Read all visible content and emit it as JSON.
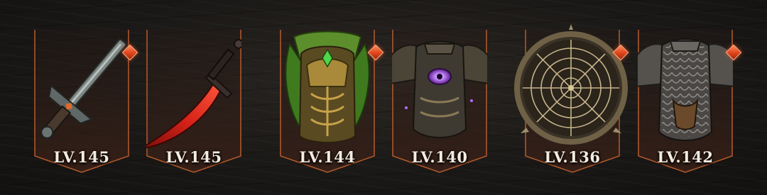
{
  "accent_color": "#e0551f",
  "frame_color": "#b55a2c",
  "equipment": [
    {
      "slot": "sword",
      "icon": "broadsword-icon",
      "level": "LV.145",
      "enhanced": true
    },
    {
      "slot": "dagger",
      "icon": "red-dagger-icon",
      "level": "LV.145",
      "enhanced": false
    },
    {
      "slot": "helmet",
      "icon": "leaf-helmet-icon",
      "level": "LV.144",
      "enhanced": true
    },
    {
      "slot": "chest",
      "icon": "eye-armor-icon",
      "level": "LV.140",
      "enhanced": false
    },
    {
      "slot": "shield",
      "icon": "spiderweb-shield-icon",
      "level": "LV.136",
      "enhanced": true
    },
    {
      "slot": "body-armor",
      "icon": "scale-armor-icon",
      "level": "LV.142",
      "enhanced": true
    }
  ]
}
